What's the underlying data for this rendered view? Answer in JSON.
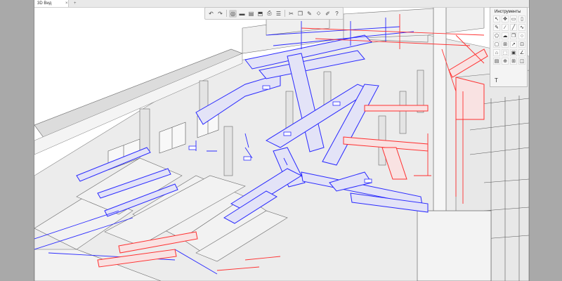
{
  "tabs": {
    "active_label": "3D Вид",
    "close_glyph": "×",
    "add_glyph": "+"
  },
  "toolbar": {
    "buttons": [
      {
        "name": "undo-icon",
        "glyph": "↶"
      },
      {
        "name": "redo-icon",
        "glyph": "↷"
      },
      {
        "name": "orbit-icon",
        "glyph": "◎"
      },
      {
        "name": "display-mode-icon",
        "glyph": "▬"
      },
      {
        "name": "print-icon",
        "glyph": "▤"
      },
      {
        "name": "section-icon",
        "glyph": "⬒"
      },
      {
        "name": "printer-icon",
        "glyph": "⎙"
      },
      {
        "name": "layers-icon",
        "glyph": "☰"
      },
      {
        "name": "scissors-icon",
        "glyph": "✂"
      },
      {
        "name": "duplicate-icon",
        "glyph": "❐"
      },
      {
        "name": "edit-icon",
        "glyph": "✎"
      },
      {
        "name": "pick-icon",
        "glyph": "⬦"
      },
      {
        "name": "pencil-icon",
        "glyph": "✐"
      },
      {
        "name": "help-icon",
        "glyph": "?"
      }
    ]
  },
  "tools_panel": {
    "title": "Инструменты",
    "tools": [
      {
        "name": "select-tool-icon",
        "glyph": "↖"
      },
      {
        "name": "pan-tool-icon",
        "glyph": "✥"
      },
      {
        "name": "rect-tool-icon",
        "glyph": "▭"
      },
      {
        "name": "rect2-tool-icon",
        "glyph": "▯"
      },
      {
        "name": "pen-tool-icon",
        "glyph": "✎"
      },
      {
        "name": "brush-tool-icon",
        "glyph": "∕"
      },
      {
        "name": "line-tool-icon",
        "glyph": "╱"
      },
      {
        "name": "curve-tool-icon",
        "glyph": "∿"
      },
      {
        "name": "polygon-tool-icon",
        "glyph": "⬠"
      },
      {
        "name": "cloud-tool-icon",
        "glyph": "☁"
      },
      {
        "name": "copy-tool-icon",
        "glyph": "❐"
      },
      {
        "name": "circle-tool-icon",
        "glyph": "○"
      },
      {
        "name": "box-tool-icon",
        "glyph": "▢"
      },
      {
        "name": "measure-tool-icon",
        "glyph": "⊞"
      },
      {
        "name": "arrow-tool-icon",
        "glyph": "➚"
      },
      {
        "name": "stamp-tool-icon",
        "glyph": "⊡"
      },
      {
        "name": "tag-tool-icon",
        "glyph": "⌂"
      },
      {
        "name": "frame-tool-icon",
        "glyph": "⬚"
      },
      {
        "name": "area-tool-icon",
        "glyph": "▣"
      },
      {
        "name": "angle-tool-icon",
        "glyph": "∠"
      },
      {
        "name": "note-tool-icon",
        "glyph": "▤"
      },
      {
        "name": "zoom-tool-icon",
        "glyph": "⊕"
      },
      {
        "name": "grid-tool-icon",
        "glyph": "⊞"
      },
      {
        "name": "marker-tool-icon",
        "glyph": "◫"
      }
    ],
    "text_tool_glyph": "T"
  },
  "colors": {
    "supply_duct": "#2a2aff",
    "return_duct": "#ff3030",
    "building": "#7a7a7a",
    "frame": "#a9a9a9"
  }
}
